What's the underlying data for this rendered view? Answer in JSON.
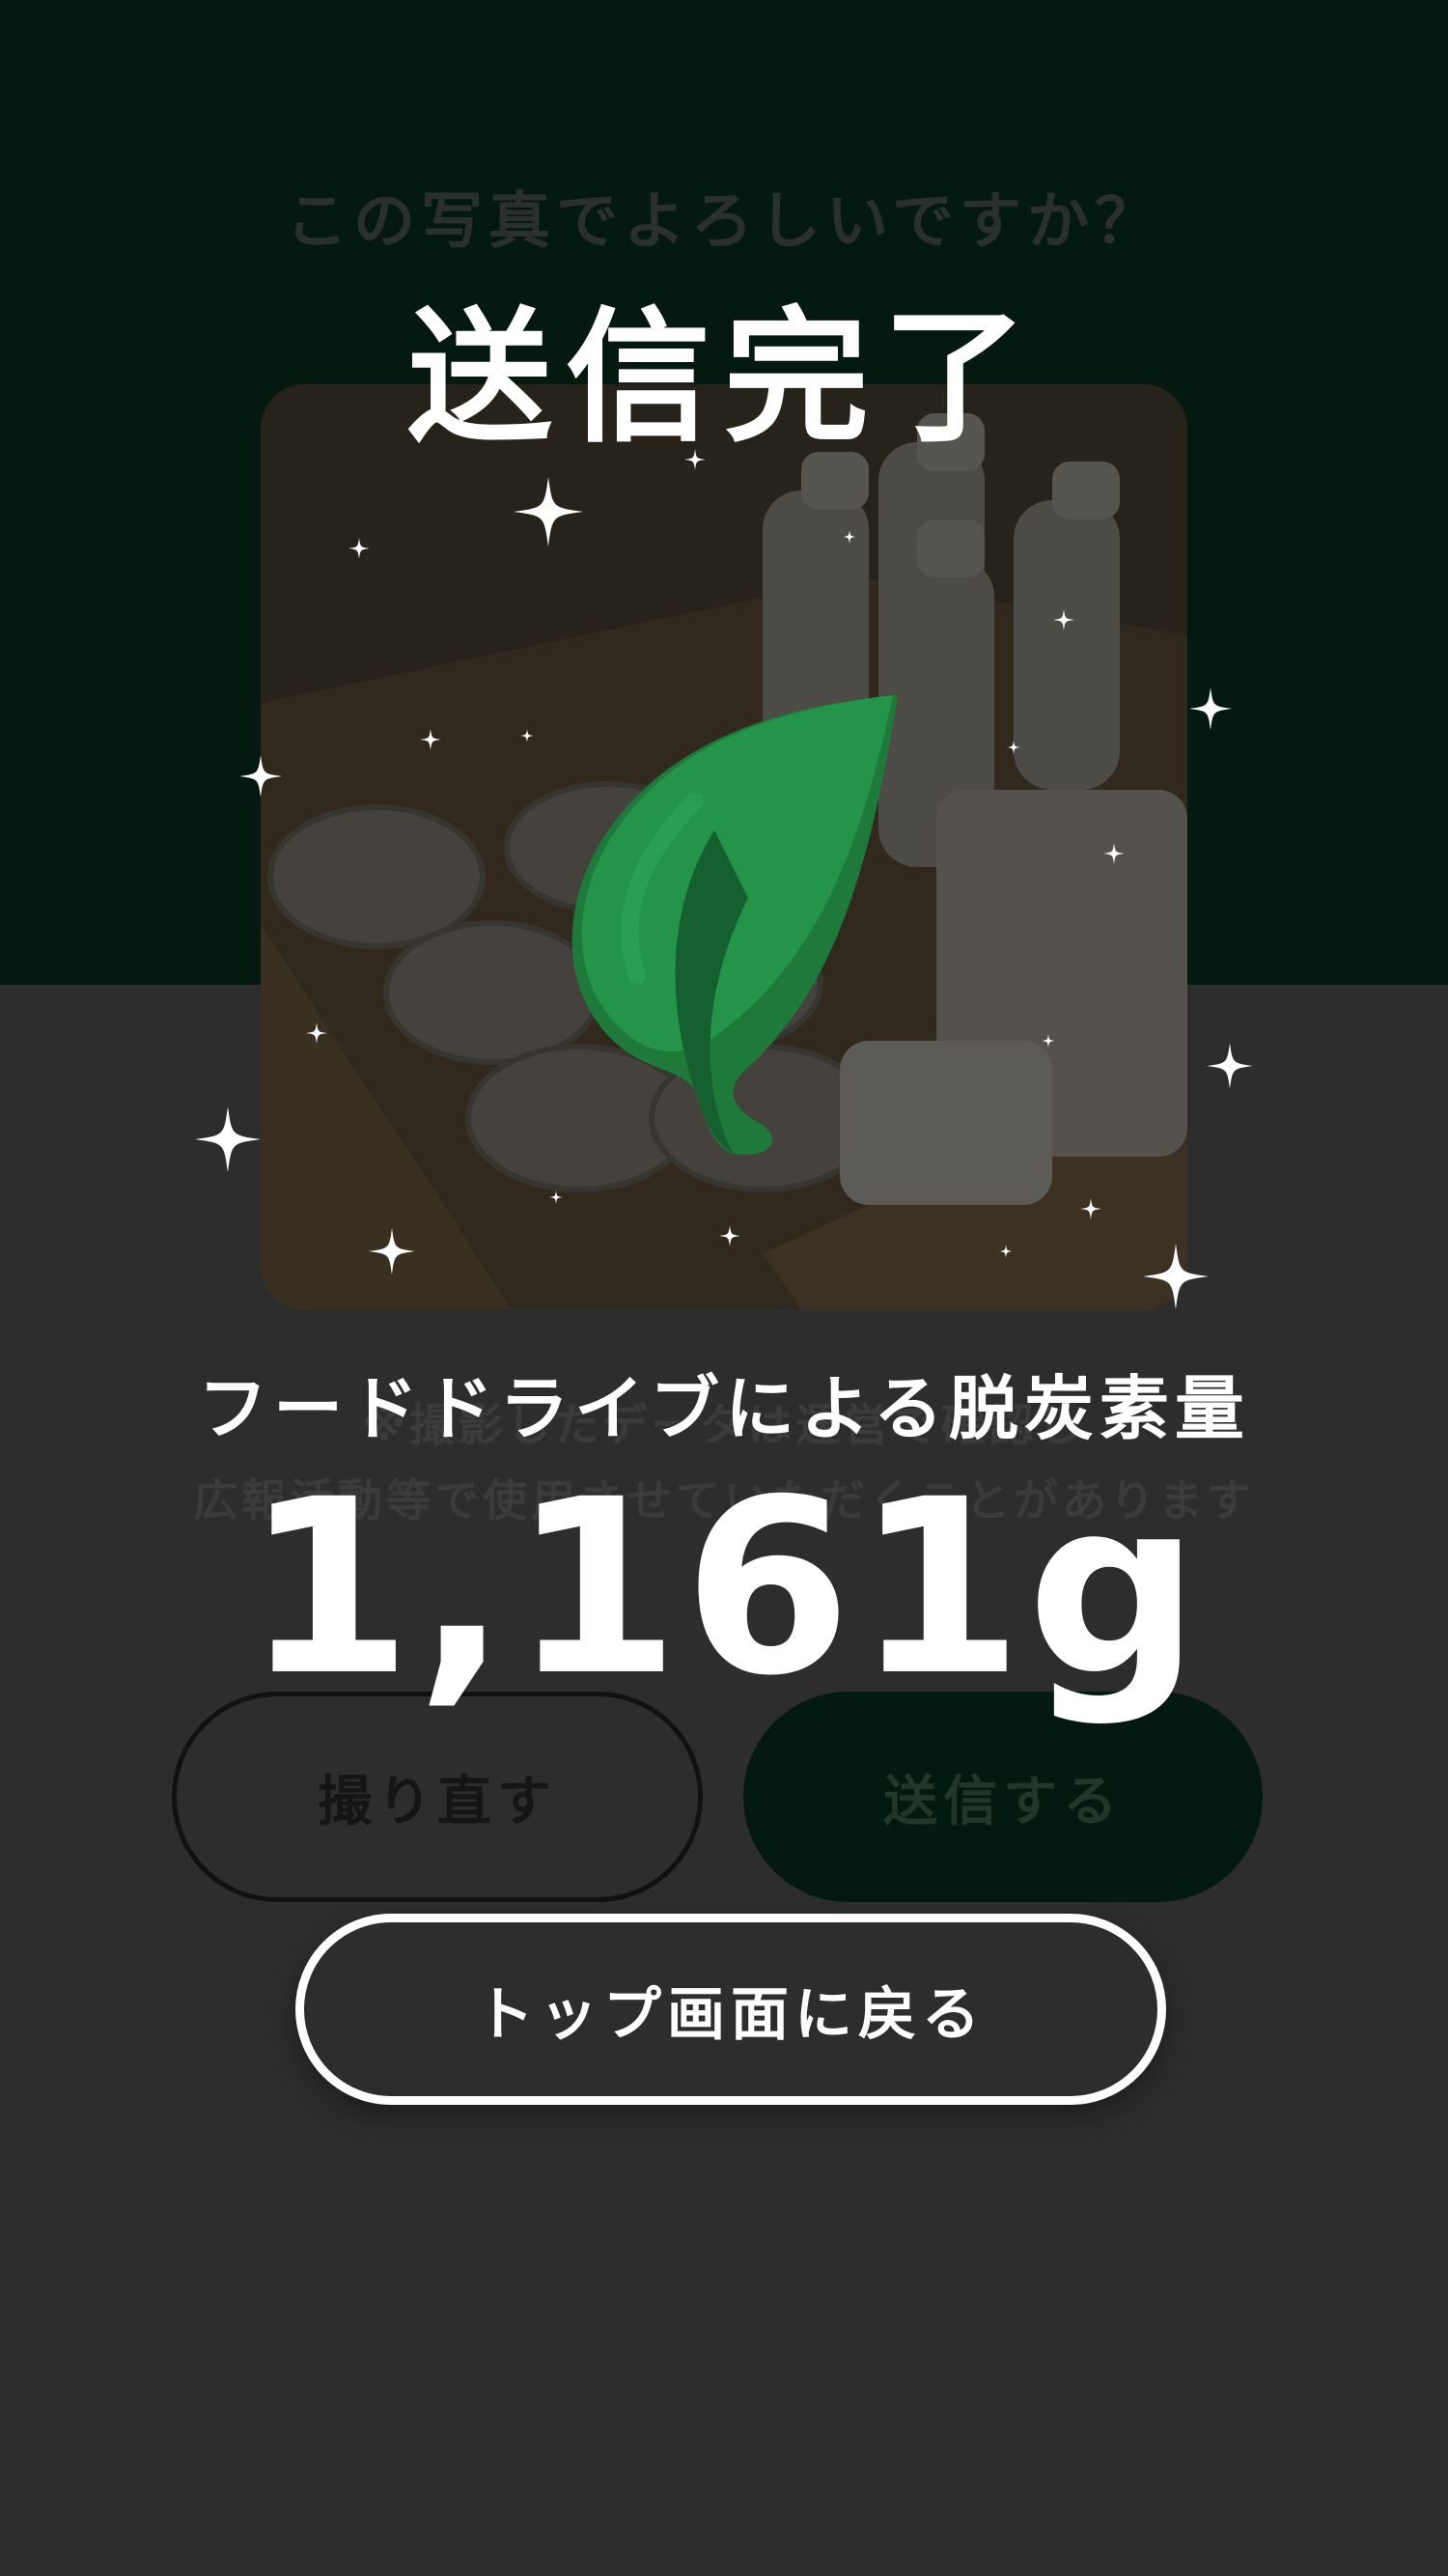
{
  "background_screen": {
    "title": "この写真でよろしいですか？",
    "notice_line1": "※撮影したデータは運営で確認し",
    "notice_line2": "広報活動等で使用させていただくことがあります",
    "retake_button": "撮り直す",
    "send_button": "送信する"
  },
  "completion_overlay": {
    "title": "送信完了",
    "co2_label": "フードドライブによる脱炭素量",
    "co2_value": "1,161g",
    "home_button": "トップ画面に戻る",
    "icon": "leaf-icon"
  },
  "colors": {
    "top_band": "#041a10",
    "background": "#2d2d2d",
    "leaf": "#239449",
    "text": "#ffffff"
  }
}
